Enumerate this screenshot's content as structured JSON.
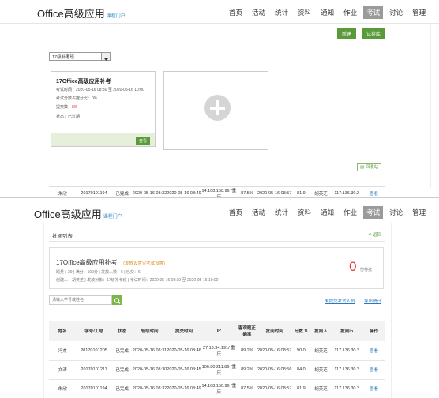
{
  "top": {
    "brand_title": "Office高级应用",
    "brand_sub": "课程门户",
    "nav": [
      "首页",
      "活动",
      "统计",
      "资料",
      "通知",
      "作业",
      "考试",
      "讨论",
      "管理"
    ],
    "btn_new": "新建",
    "btn_bank": "试卷库",
    "select_value": "17级补考班",
    "card": {
      "title": "17Office高级应用补考",
      "time": "考试时间：2020-05-16 08:30 至 2020-05-16 10:00",
      "weight": "考试分数占据分比：0%",
      "submit_label": "提交数：",
      "submit_value": "8/6",
      "status": "状态：已过期",
      "review_btn": "查看"
    },
    "recycle": "回收站",
    "partial_row": [
      "朱欣",
      "20170101194",
      "已完成",
      "2020-05-16 08:32",
      "2020-05-16 08:49",
      "14.108.150.96 /重庆",
      "87.5%",
      "2020-05-16 08:57",
      "81.9",
      "胡英芝",
      "117.136.30.2",
      "查看"
    ]
  },
  "bottom": {
    "brand_title": "Office高级应用",
    "brand_sub": "课程门户",
    "nav": [
      "首页",
      "活动",
      "统计",
      "资料",
      "通知",
      "作业",
      "考试",
      "讨论",
      "管理"
    ],
    "section_title": "批阅列表",
    "back": "返回",
    "exam_title": "17Office高级应用补考",
    "exam_links": "(发放设置)  (考试设置)",
    "meta1": "题量：29 | 满分：100分 | 发放人数：6 | 已交：6",
    "meta2": "创建人：胡英芝 | 发放对象：17级补考班 | 考试时间：2020-05-16 08:30 至 2020-05-16 10:00",
    "pending_num": "0",
    "pending_label": "份待批",
    "search_placeholder": "请输入学号或姓名",
    "unsubmitted": "未提交考试人员",
    "export": "导出统计",
    "headers": [
      "姓名",
      "学号/工号",
      "状态",
      "领取时间",
      "提交时间",
      "IP",
      "客观题正确率",
      "批阅时间",
      "分数",
      "批阅人",
      "批阅ip",
      "操作"
    ],
    "rows": [
      [
        "冯杰",
        "20170101205",
        "已完成",
        "2020-05-16 08:31",
        "2020-05-16 08:46",
        "27.13.34.191/ 重庆",
        "89.2%",
        "2020-05-16 08:57",
        "90.0",
        "胡英芝",
        "117.136.30.2",
        "查看"
      ],
      [
        "文涛",
        "20170101211",
        "已完成",
        "2020-05-16 08:30",
        "2020-05-16 08:45",
        "106.80.211.86 /重庆",
        "89.2%",
        "2020-05-16 08:56",
        "84.0",
        "胡英芝",
        "117.136.30.2",
        "查看"
      ],
      [
        "朱欣",
        "20170101194",
        "已完成",
        "2020-05-16 08:32",
        "2020-05-16 08:49",
        "14.108.150.96 /重庆",
        "87.5%",
        "2020-05-16 08:57",
        "81.9",
        "胡英芝",
        "117.136.30.2",
        "查看"
      ]
    ]
  }
}
